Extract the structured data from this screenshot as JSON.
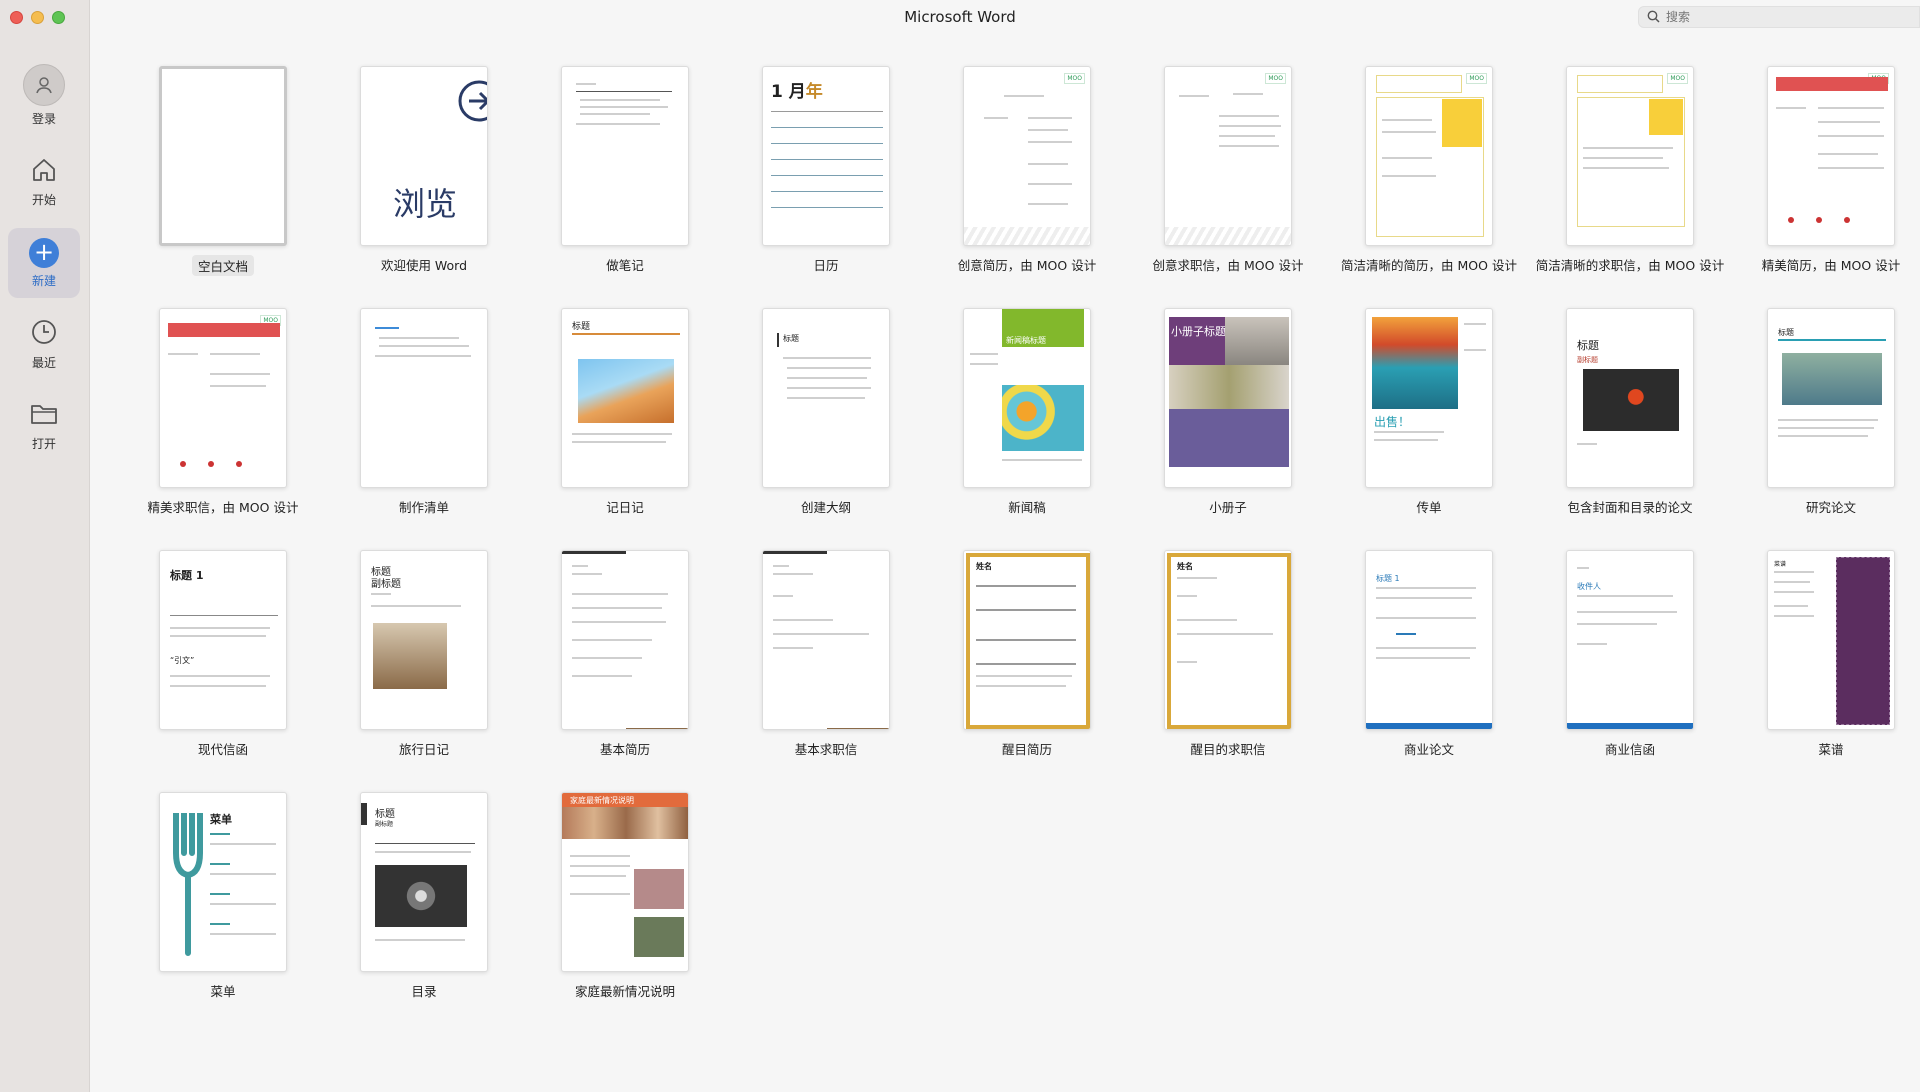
{
  "window": {
    "title": "Microsoft Word"
  },
  "search": {
    "placeholder": "搜索"
  },
  "sidebar": {
    "items": [
      {
        "label": "登录",
        "icon": "person-icon"
      },
      {
        "label": "开始",
        "icon": "home-icon"
      },
      {
        "label": "新建",
        "icon": "plus-icon",
        "active": true
      },
      {
        "label": "最近",
        "icon": "clock-icon"
      },
      {
        "label": "打开",
        "icon": "folder-icon"
      }
    ]
  },
  "accent_color": "#3f7fd8",
  "templates": [
    {
      "label": "空白文档"
    },
    {
      "label": "欢迎使用 Word",
      "thumb_text": "浏览"
    },
    {
      "label": "做笔记"
    },
    {
      "label": "日历",
      "thumb_text_1": "1 月",
      "thumb_text_2": "年"
    },
    {
      "label": "创意简历，由 MOO 设计"
    },
    {
      "label": "创意求职信，由 MOO 设计"
    },
    {
      "label": "简洁清晰的简历，由 MOO 设计"
    },
    {
      "label": "简洁清晰的求职信，由 MOO 设计"
    },
    {
      "label": "精美简历，由 MOO 设计"
    },
    {
      "label": "精美求职信，由 MOO 设计"
    },
    {
      "label": "制作清单"
    },
    {
      "label": "记日记",
      "thumb_text": "标题"
    },
    {
      "label": "创建大纲",
      "thumb_text": "标题"
    },
    {
      "label": "新闻稿",
      "thumb_text": "新闻稿标题"
    },
    {
      "label": "小册子",
      "thumb_text": "小册子标题"
    },
    {
      "label": "传单",
      "thumb_text": "出售！"
    },
    {
      "label": "包含封面和目录的论文",
      "thumb_text_1": "标题",
      "thumb_text_2": "副标题"
    },
    {
      "label": "研究论文",
      "thumb_text": "标题"
    },
    {
      "label": "现代信函",
      "thumb_text_1": "标题 1",
      "thumb_text_2": "“引文”"
    },
    {
      "label": "旅行日记",
      "thumb_text_1": "标题",
      "thumb_text_2": "副标题"
    },
    {
      "label": "基本简历"
    },
    {
      "label": "基本求职信"
    },
    {
      "label": "醒目简历",
      "thumb_text": "姓名"
    },
    {
      "label": "醒目的求职信",
      "thumb_text": "姓名"
    },
    {
      "label": "商业论文",
      "thumb_text": "标题 1"
    },
    {
      "label": "商业信函",
      "thumb_text": "收件人"
    },
    {
      "label": "菜谱",
      "thumb_text": "菜谱"
    },
    {
      "label": "菜单",
      "thumb_text": "菜单"
    },
    {
      "label": "目录",
      "thumb_text_1": "标题",
      "thumb_text_2": "副标题"
    },
    {
      "label": "家庭最新情况说明",
      "thumb_text": "家庭最新情况说明"
    }
  ]
}
